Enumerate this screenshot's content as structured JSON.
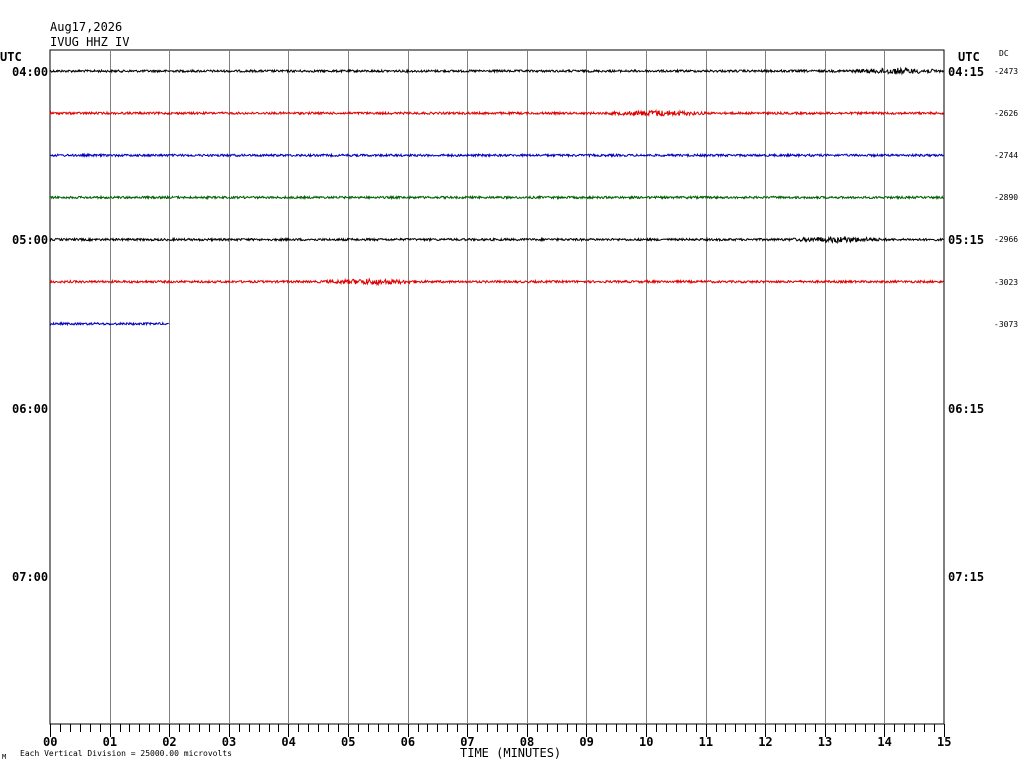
{
  "header": {
    "date": "Aug17,2026",
    "station": "IVUG HHZ IV"
  },
  "left_axis": {
    "title": "UTC",
    "labels": [
      "04:00",
      "05:00",
      "06:00",
      "07:00"
    ]
  },
  "right_axis": {
    "title": "UTC",
    "dc_title": "DC",
    "labels": [
      "04:15",
      "05:15",
      "06:15",
      "07:15"
    ]
  },
  "footer": {
    "note": "Each Vertical Division = 25000.00 microvolts",
    "corner_mark": "M"
  },
  "chart_data": {
    "type": "line",
    "title": "IVUG HHZ IV",
    "date": "Aug17,2026",
    "xlabel": "TIME (MINUTES)",
    "x_ticks": [
      "00",
      "01",
      "02",
      "03",
      "04",
      "05",
      "06",
      "07",
      "08",
      "09",
      "10",
      "11",
      "12",
      "13",
      "14",
      "15"
    ],
    "xlim": [
      0,
      15
    ],
    "rows_total": 16,
    "row_minutes": 15,
    "grid": true,
    "colors": [
      "#000000",
      "#e00000",
      "#0000c0",
      "#006000"
    ],
    "series": [
      {
        "start": "04:00",
        "dc": "-2473",
        "color": "#000000",
        "end_minute": 15,
        "burst_minute": 14.2
      },
      {
        "start": "04:15",
        "dc": "-2626",
        "color": "#e00000",
        "end_minute": 15,
        "burst_minute": 10.2
      },
      {
        "start": "04:30",
        "dc": "-2744",
        "color": "#0000c0",
        "end_minute": 15,
        "burst_minute": null
      },
      {
        "start": "04:45",
        "dc": "-2890",
        "color": "#006000",
        "end_minute": 15,
        "burst_minute": null
      },
      {
        "start": "05:00",
        "dc": "-2966",
        "color": "#000000",
        "end_minute": 15,
        "burst_minute": 13.2
      },
      {
        "start": "05:15",
        "dc": "-3023",
        "color": "#e00000",
        "end_minute": 15,
        "burst_minute": 5.4
      },
      {
        "start": "05:30",
        "dc": "-3073",
        "color": "#0000c0",
        "end_minute": 2,
        "burst_minute": null
      }
    ]
  }
}
